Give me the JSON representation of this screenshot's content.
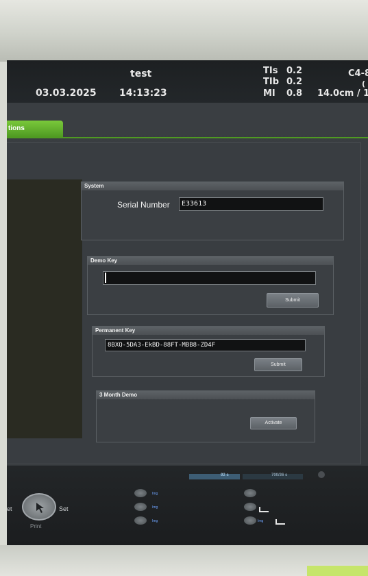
{
  "header": {
    "patient_name": "test",
    "date": "03.03.2025",
    "time": "14:13:23",
    "tis_label": "TIs",
    "tis_value": "0.2",
    "tib_label": "TIb",
    "tib_value": "0.2",
    "mi_label": "MI",
    "mi_value": "0.8",
    "probe": "C4-8",
    "depth": "14.0cm / 1",
    "extra": "("
  },
  "tabs": {
    "active_label": "tions"
  },
  "system": {
    "title": "System",
    "serial_label": "Serial Number",
    "serial_value": "E33613"
  },
  "demo_key": {
    "title": "Demo Key",
    "value": "",
    "submit_label": "Submit"
  },
  "permanent_key": {
    "title": "Permanent Key",
    "value": "8BXQ-5DA3-EkBD-88FT-MBB8-ZD4F",
    "submit_label": "Submit"
  },
  "three_month": {
    "title": "3 Month Demo",
    "activate_label": "Activate"
  },
  "status": {
    "left_value": "92 s",
    "right_value": "700/36 s"
  },
  "controls": {
    "set_left": "et",
    "set_right": "Set",
    "print": "Print",
    "img": "Img"
  },
  "colors": {
    "accent": "#5cae2c",
    "key_blue": "#6fa4ff"
  },
  "icons": [
    "cursor-arrow-icon",
    "rotary-knob-icon",
    "printer-icon"
  ]
}
